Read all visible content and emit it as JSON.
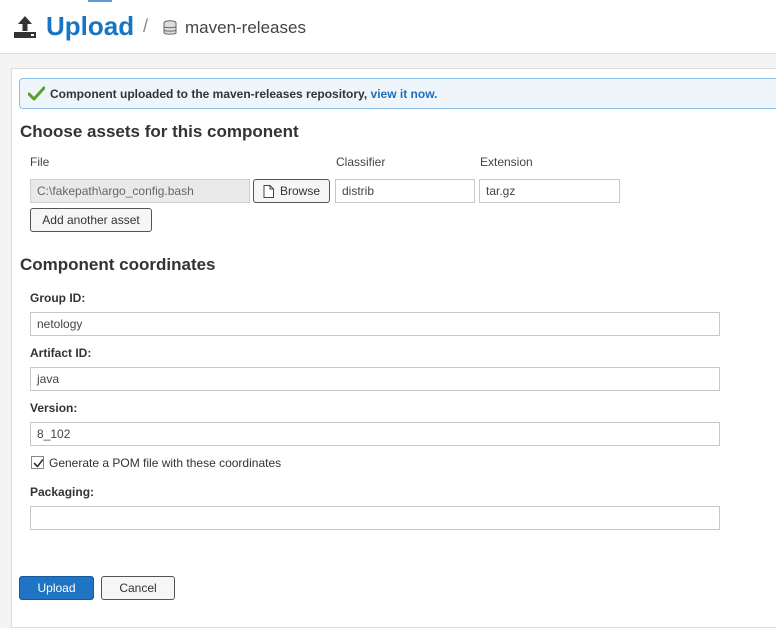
{
  "header": {
    "title": "Upload",
    "separator": "/",
    "repository": "maven-releases",
    "icons": {
      "upload": "upload-icon",
      "repository": "database-icon"
    }
  },
  "alert": {
    "message": "Component uploaded to the maven-releases repository,",
    "link_text": "view it now.",
    "icon": "check-icon",
    "colors": {
      "background": "#eef6fc",
      "border": "#8cc0e8",
      "link": "#1f6fb8"
    }
  },
  "assets": {
    "heading": "Choose assets for this component",
    "columns": {
      "file": "File",
      "classifier": "Classifier",
      "extension": "Extension"
    },
    "file_value": "C:\\fakepath\\argo_config.bash",
    "browse_label": "Browse",
    "classifier_value": "distrib",
    "extension_value": "tar.gz",
    "add_asset_label": "Add another asset"
  },
  "coordinates": {
    "heading": "Component coordinates",
    "group_id": {
      "label": "Group ID:",
      "value": "netology"
    },
    "artifact_id": {
      "label": "Artifact ID:",
      "value": "java"
    },
    "version": {
      "label": "Version:",
      "value": "8_102"
    },
    "generate_pom": {
      "label": "Generate a POM file with these coordinates",
      "checked": true
    },
    "packaging": {
      "label": "Packaging:",
      "value": ""
    }
  },
  "actions": {
    "upload_label": "Upload",
    "cancel_label": "Cancel"
  },
  "colors": {
    "accent": "#1875c4",
    "primary_button": "#1f74c4"
  }
}
